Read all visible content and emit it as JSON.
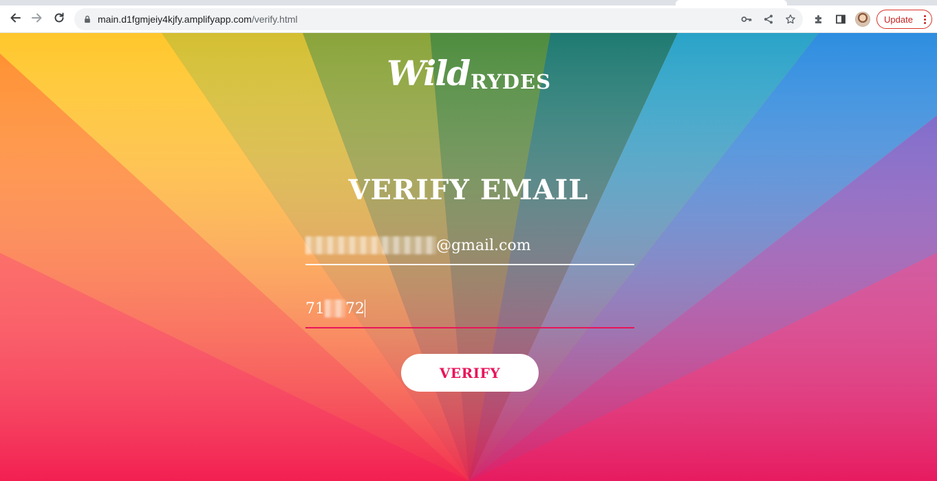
{
  "browser": {
    "url_host": "main.d1fgmjeiy4kjfy.amplifyapp.com",
    "url_path": "/verify.html",
    "update_label": "Update"
  },
  "icons": {
    "back": "back-arrow-icon",
    "forward": "forward-arrow-icon",
    "reload": "reload-icon",
    "lock": "lock-icon",
    "key": "key-icon",
    "share": "share-icon",
    "bookmark": "star-icon",
    "extensions": "puzzle-icon",
    "side_panel": "side-panel-icon",
    "menu": "kebab-menu-icon"
  },
  "logo": {
    "script": "Wild",
    "block": "RYDES"
  },
  "form": {
    "title": "VERIFY EMAIL",
    "email_suffix": "@gmail.com",
    "code_prefix": "71",
    "code_suffix": "72",
    "submit_label": "VERIFY"
  },
  "colors": {
    "accent": "#e8155a",
    "update": "#c5221f"
  }
}
